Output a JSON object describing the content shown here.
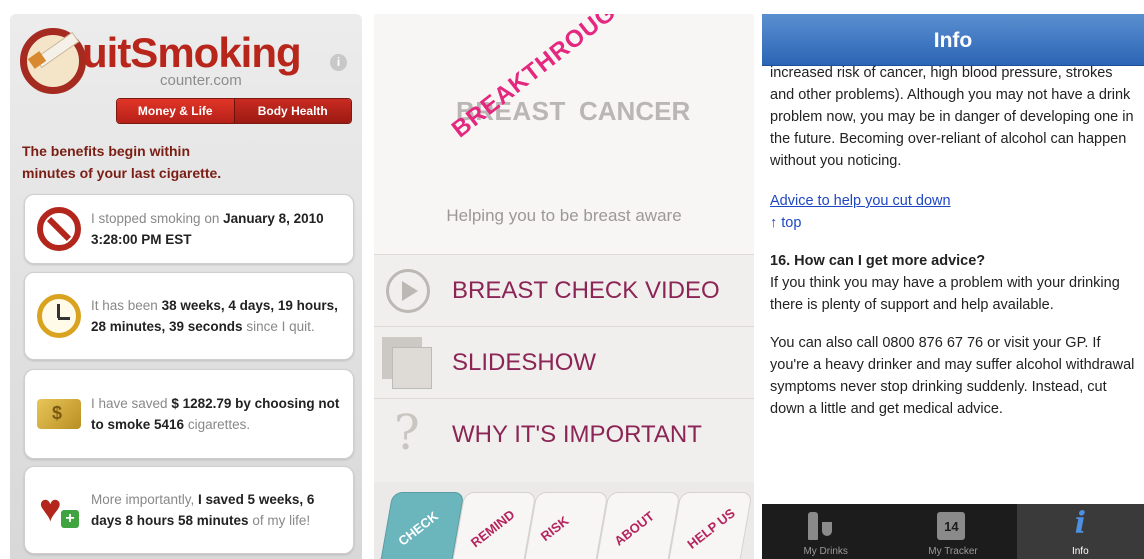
{
  "quit_smoking": {
    "logo_q": "Q",
    "logo_title": "uitSmoking",
    "logo_sub": "counter.com",
    "info_icon": "i",
    "tabs": [
      {
        "label": "Money & Life",
        "active": true
      },
      {
        "label": "Body Health",
        "active": false
      }
    ],
    "lead_line1": "The benefits begin within",
    "lead_line2": "minutes of your last cigarette.",
    "cards": [
      {
        "icon": "no-smoking-icon",
        "pre": "I stopped smoking on ",
        "bold": "January 8, 2010 3:28:00 PM EST",
        "post": ""
      },
      {
        "icon": "clock-icon",
        "pre": "It has been ",
        "bold": "38 weeks, 4 days, 19 hours, 28 minutes, 39 seconds",
        "post": " since I quit."
      },
      {
        "icon": "money-icon",
        "pre": "I have saved ",
        "bold": "$ 1282.79 by choosing not to smoke 5416",
        "post": " cigarettes."
      },
      {
        "icon": "heart-plus-icon",
        "pre": "More importantly, ",
        "bold": "I saved 5 weeks, 6 days 8 hours 58 minutes",
        "post": " of my life!"
      }
    ],
    "colors": {
      "brand": "#b8251b",
      "tab": "#c92b21"
    }
  },
  "breast_cancer": {
    "logo_left": "BREAST",
    "logo_right": "CANCER",
    "logo_overlay": "BREAKTHROUGH",
    "tagline": "Helping you to be breast aware",
    "menu": [
      {
        "label": "BREAST CHECK VIDEO",
        "icon": "play-icon"
      },
      {
        "label": "SLIDESHOW",
        "icon": "slideshow-icon"
      },
      {
        "label": "WHY IT'S IMPORTANT",
        "icon": "question-icon"
      }
    ],
    "tabs": [
      {
        "label": "CHECK",
        "active": true
      },
      {
        "label": "REMIND",
        "active": false
      },
      {
        "label": "RISK",
        "active": false
      },
      {
        "label": "ABOUT",
        "active": false
      },
      {
        "label": "HELP US",
        "active": false
      }
    ],
    "colors": {
      "accent": "#8b2555",
      "pink": "#e5287f",
      "active_tab": "#6bb5bd"
    }
  },
  "info": {
    "title": "Info",
    "para1": "increased risk of cancer, high blood pressure, strokes and other problems). Although you may not have a drink problem now, you may be in danger of developing one in the future. Becoming over-reliant of alcohol can happen without you noticing.",
    "link_advice": "Advice to help you cut down",
    "link_top": "↑ top",
    "question": "16. How can I get more advice?",
    "para2": "If you think you may have a problem with your drinking there is plenty of support and help available.",
    "para3": "You can also call 0800 876 67 76 or visit your GP. If you're a heavy drinker and may suffer alcohol withdrawal symptoms never stop drinking suddenly. Instead, cut down a little and get medical advice.",
    "tabbar": [
      {
        "label": "My Drinks",
        "icon": "drinks-icon",
        "active": false
      },
      {
        "label": "My Tracker",
        "icon": "calendar-icon",
        "calendar_day": "14",
        "active": false
      },
      {
        "label": "Info",
        "icon": "info-icon",
        "glyph": "i",
        "active": true
      }
    ],
    "colors": {
      "navbar": "#2c65b5",
      "link": "#1f47c4"
    }
  }
}
